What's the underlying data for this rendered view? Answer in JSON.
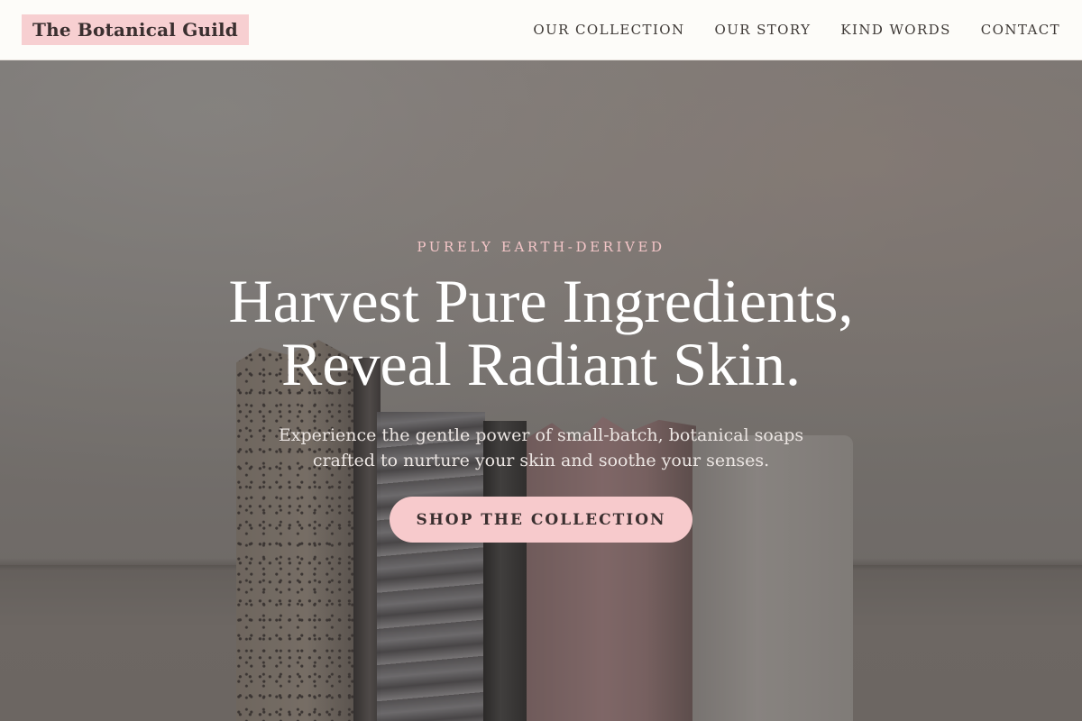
{
  "brand": {
    "name": "The Botanical Guild"
  },
  "nav": {
    "items": [
      {
        "label": "OUR COLLECTION"
      },
      {
        "label": "OUR STORY"
      },
      {
        "label": "KIND WORDS"
      },
      {
        "label": "CONTACT"
      }
    ]
  },
  "hero": {
    "eyebrow": "PURELY EARTH-DERIVED",
    "headline_line1": "Harvest Pure Ingredients,",
    "headline_line2": "Reveal Radiant Skin.",
    "subtext_line1": "Experience the gentle power of small-batch, botanical soaps",
    "subtext_line2": "crafted to nurture your skin and soothe your senses.",
    "cta_label": "SHOP THE COLLECTION"
  },
  "colors": {
    "accent_pink": "#f7cacc",
    "eyebrow_pink": "#f4c6c8",
    "header_bg": "#fdfcf9",
    "text_dark": "#3a2f2f"
  }
}
